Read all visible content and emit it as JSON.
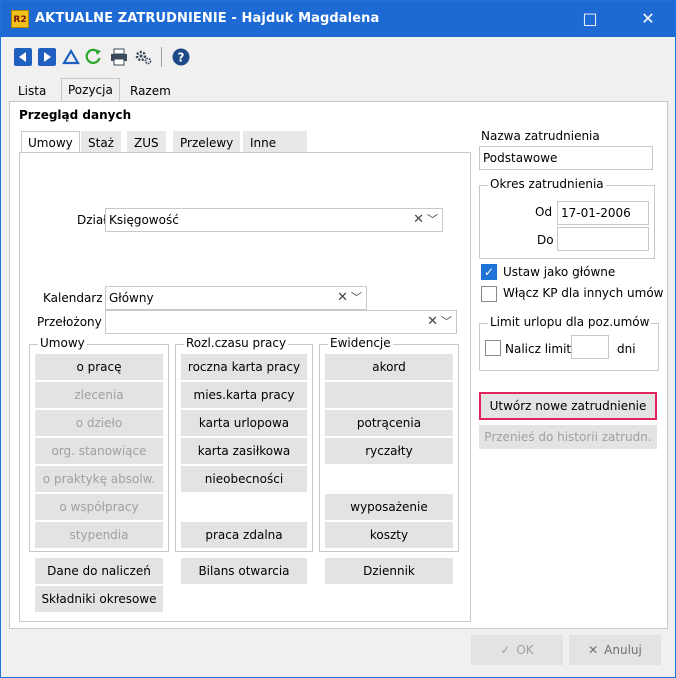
{
  "window": {
    "app_icon": "R2",
    "title": "AKTUALNE ZATRUDNIENIE - Hajduk Magdalena",
    "minimize": "□",
    "close": "✕"
  },
  "toolbar": {
    "icons": [
      "first-icon",
      "next-icon",
      "up-icon",
      "refresh-icon",
      "print-icon",
      "settings-icon",
      "help-icon"
    ]
  },
  "main_tabs": [
    "Lista",
    "Pozycja",
    "Razem"
  ],
  "section_title": "Przegląd danych",
  "sub_tabs": [
    "Umowy",
    "Staż",
    "ZUS",
    "Przelewy",
    "Inne"
  ],
  "fields": {
    "dzial_label": "Dział",
    "dzial_value": "Księgowość",
    "kalendarz_label": "Kalendarz",
    "kalendarz_value": "Główny",
    "przelozony_label": "Przełożony",
    "przelozony_value": ""
  },
  "groups": {
    "umowy": {
      "title": "Umowy",
      "items": [
        {
          "label": "o pracę",
          "enabled": true
        },
        {
          "label": "zlecenia",
          "enabled": false
        },
        {
          "label": "o dzieło",
          "enabled": false
        },
        {
          "label": "org. stanowiące",
          "enabled": false
        },
        {
          "label": "o praktykę absolw.",
          "enabled": false
        },
        {
          "label": "o współpracy",
          "enabled": false
        },
        {
          "label": "stypendia",
          "enabled": false
        }
      ]
    },
    "rozl": {
      "title": "Rozl.czasu pracy",
      "items": [
        "roczna karta pracy",
        "mies.karta pracy",
        "karta urlopowa",
        "karta zasiłkowa",
        "nieobecności",
        "praca zdalna"
      ]
    },
    "ewidencje": {
      "title": "Ewidencje",
      "items": [
        "akord",
        "potrącenia",
        "ryczałty",
        "wyposażenie",
        "koszty"
      ]
    }
  },
  "bottom_buttons": {
    "dane": "Dane do naliczeń",
    "skladniki": "Składniki okresowe",
    "bilans": "Bilans otwarcia",
    "dziennik": "Dziennik"
  },
  "right": {
    "nazwa_label": "Nazwa zatrudnienia",
    "nazwa_value": "Podstawowe",
    "okres_title": "Okres zatrudnienia",
    "od_label": "Od",
    "od_value": "17-01-2006",
    "do_label": "Do",
    "do_value": "",
    "ustaw_label": "Ustaw jako główne",
    "ustaw_checked": true,
    "wlacz_label": "Włącz KP dla innych umów",
    "wlacz_checked": false,
    "limit_title": "Limit urlopu dla poz.umów",
    "nalicz_label": "Nalicz limit",
    "nalicz_value": "",
    "dni_label": "dni",
    "utworz_label": "Utwórz nowe zatrudnienie",
    "przenies_label": "Przenieś do historii zatrudn."
  },
  "footer": {
    "ok_label": "OK",
    "anuluj_label": "Anuluj"
  },
  "colors": {
    "titlebar": "#1d6ad5",
    "highlight": "#e3245c",
    "checkbox": "#1e73d8"
  }
}
